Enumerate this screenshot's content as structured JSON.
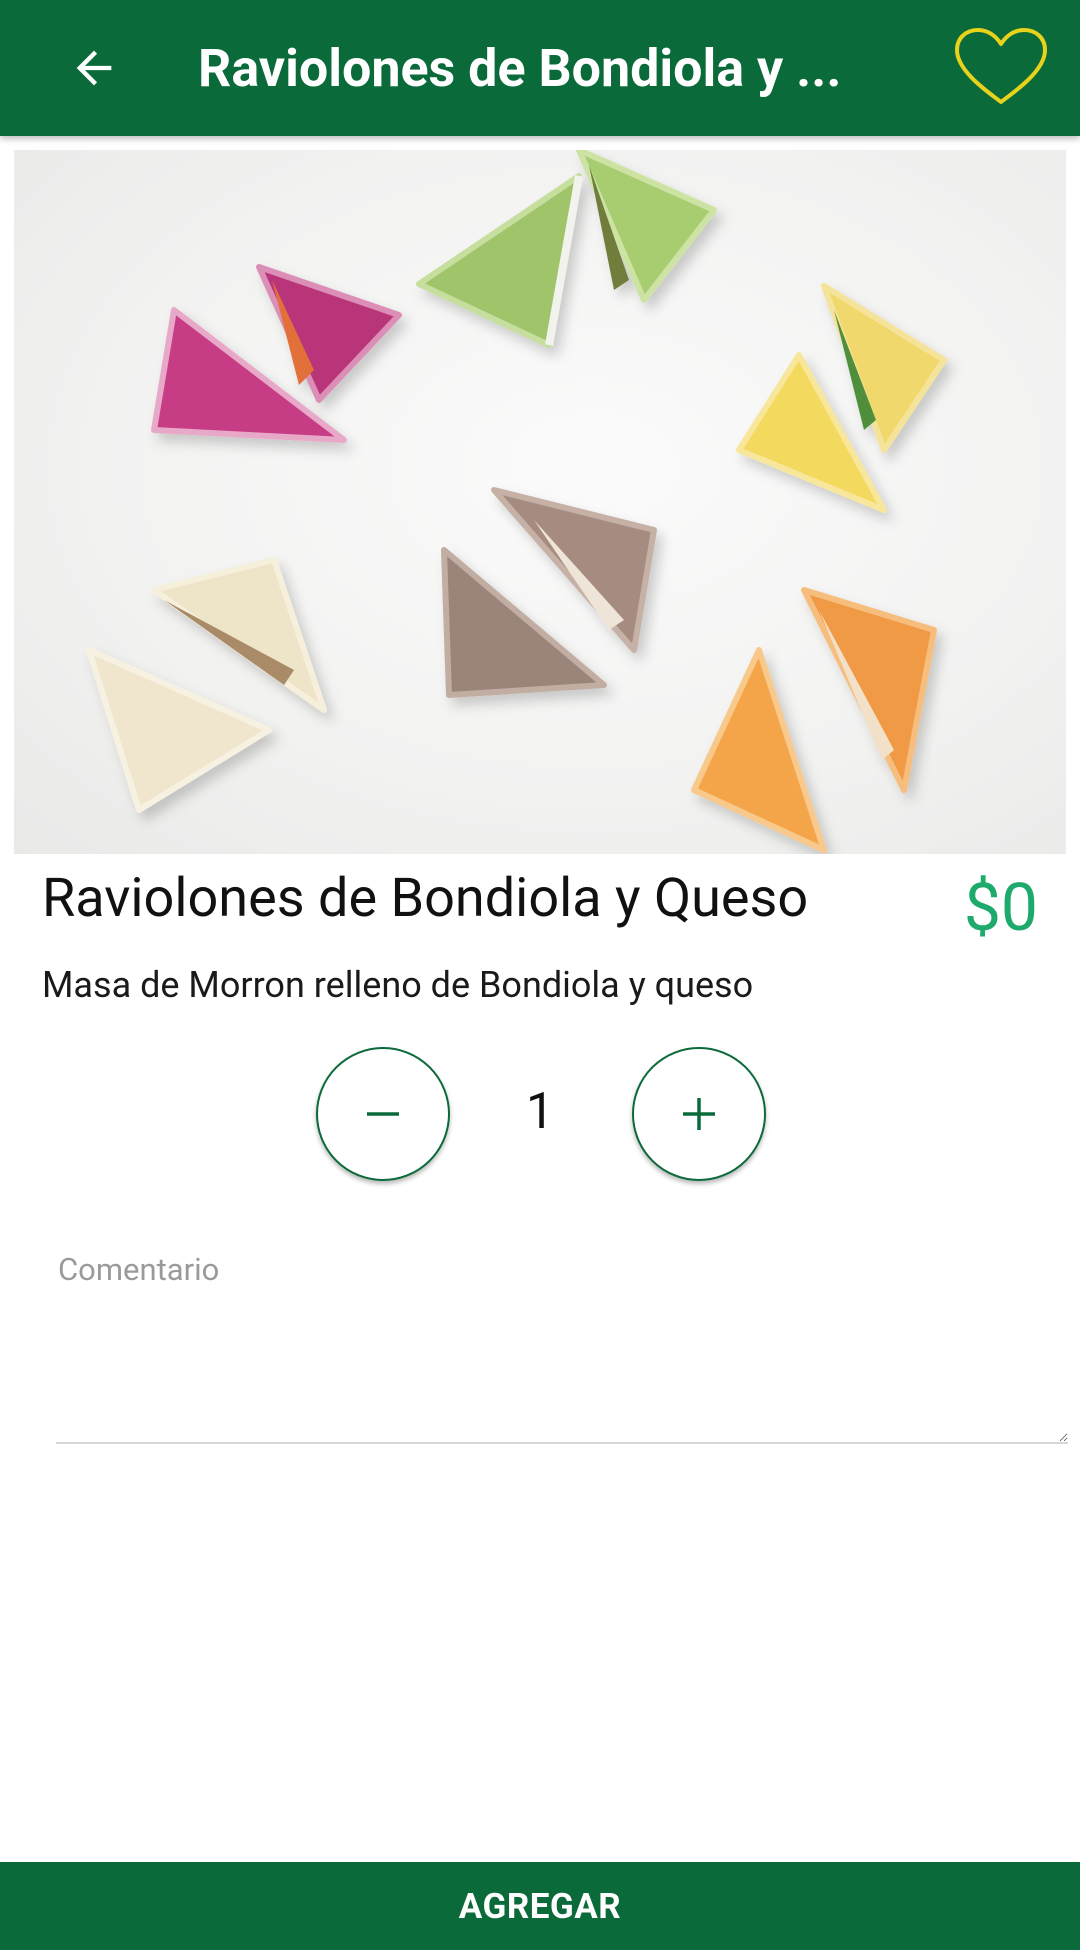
{
  "header": {
    "title": "Raviolones de Bondiola y ...",
    "back_icon": "arrow-back-icon",
    "favorite_icon": "heart-outline-icon",
    "background_color": "#0b6a3a",
    "favorite_color": "#e7d31b"
  },
  "product": {
    "name": "Raviolones de Bondiola y Queso",
    "price": "$0",
    "price_color": "#1faa6d",
    "description": "Masa de Morron relleno de Bondiola y queso"
  },
  "quantity": {
    "value": "1",
    "decrement_icon": "minus-icon",
    "increment_icon": "plus-icon"
  },
  "comment": {
    "label": "Comentario",
    "value": ""
  },
  "actions": {
    "add_label": "AGREGAR"
  }
}
